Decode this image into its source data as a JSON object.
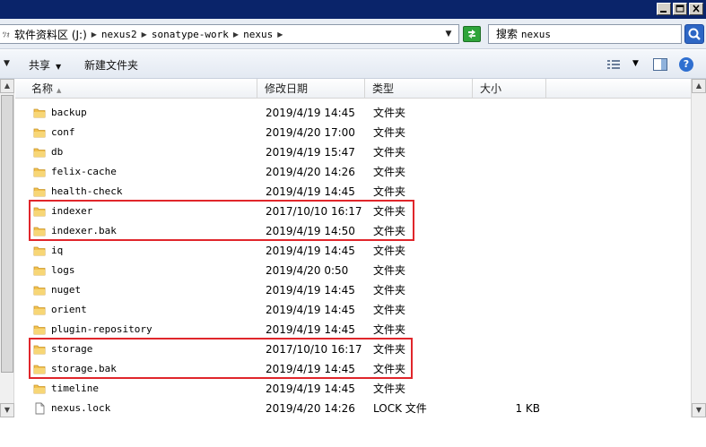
{
  "window": {
    "buttons": {
      "minimize": "minimize",
      "maximize": "maximize",
      "close": "close"
    }
  },
  "address": {
    "path": [
      {
        "label": "软件资料区 (J:)",
        "mono": false
      },
      {
        "label": "nexus2",
        "mono": true
      },
      {
        "label": "sonatype-work",
        "mono": true
      },
      {
        "label": "nexus",
        "mono": true
      }
    ],
    "search_placeholder_prefix": "搜索",
    "search_placeholder_target": "nexus"
  },
  "toolbar": {
    "share_label": "共享",
    "new_folder_label": "新建文件夹"
  },
  "columns": {
    "name": "名称",
    "modified": "修改日期",
    "type": "类型",
    "size": "大小"
  },
  "files": [
    {
      "name": "backup",
      "date": "2019/4/19 14:45",
      "type": "文件夹",
      "size": "",
      "icon": "folder-icon"
    },
    {
      "name": "conf",
      "date": "2019/4/20 17:00",
      "type": "文件夹",
      "size": "",
      "icon": "folder-icon"
    },
    {
      "name": "db",
      "date": "2019/4/19 15:47",
      "type": "文件夹",
      "size": "",
      "icon": "folder-icon"
    },
    {
      "name": "felix-cache",
      "date": "2019/4/20 14:26",
      "type": "文件夹",
      "size": "",
      "icon": "folder-icon"
    },
    {
      "name": "health-check",
      "date": "2019/4/19 14:45",
      "type": "文件夹",
      "size": "",
      "icon": "folder-icon"
    },
    {
      "name": "indexer",
      "date": "2017/10/10 16:17",
      "type": "文件夹",
      "size": "",
      "icon": "folder-icon"
    },
    {
      "name": "indexer.bak",
      "date": "2019/4/19 14:50",
      "type": "文件夹",
      "size": "",
      "icon": "folder-icon"
    },
    {
      "name": "iq",
      "date": "2019/4/19 14:45",
      "type": "文件夹",
      "size": "",
      "icon": "folder-icon"
    },
    {
      "name": "logs",
      "date": "2019/4/20 0:50",
      "type": "文件夹",
      "size": "",
      "icon": "folder-icon"
    },
    {
      "name": "nuget",
      "date": "2019/4/19 14:45",
      "type": "文件夹",
      "size": "",
      "icon": "folder-icon"
    },
    {
      "name": "orient",
      "date": "2019/4/19 14:45",
      "type": "文件夹",
      "size": "",
      "icon": "folder-icon"
    },
    {
      "name": "plugin-repository",
      "date": "2019/4/19 14:45",
      "type": "文件夹",
      "size": "",
      "icon": "folder-icon"
    },
    {
      "name": "storage",
      "date": "2017/10/10 16:17",
      "type": "文件夹",
      "size": "",
      "icon": "folder-icon"
    },
    {
      "name": "storage.bak",
      "date": "2019/4/19 14:45",
      "type": "文件夹",
      "size": "",
      "icon": "folder-icon"
    },
    {
      "name": "timeline",
      "date": "2019/4/19 14:45",
      "type": "文件夹",
      "size": "",
      "icon": "folder-icon"
    },
    {
      "name": "nexus.lock",
      "date": "2019/4/20 14:26",
      "type": "LOCK 文件",
      "size": "1 KB",
      "icon": "file-icon"
    }
  ],
  "highlights": [
    {
      "rows": [
        "indexer",
        "indexer.bak"
      ],
      "color": "#e0262b"
    },
    {
      "rows": [
        "storage",
        "storage.bak"
      ],
      "color": "#e0262b"
    }
  ],
  "colors": {
    "titlebar": "#0a246a",
    "highlight_border": "#e0262b",
    "folder": "#f2c14e"
  }
}
